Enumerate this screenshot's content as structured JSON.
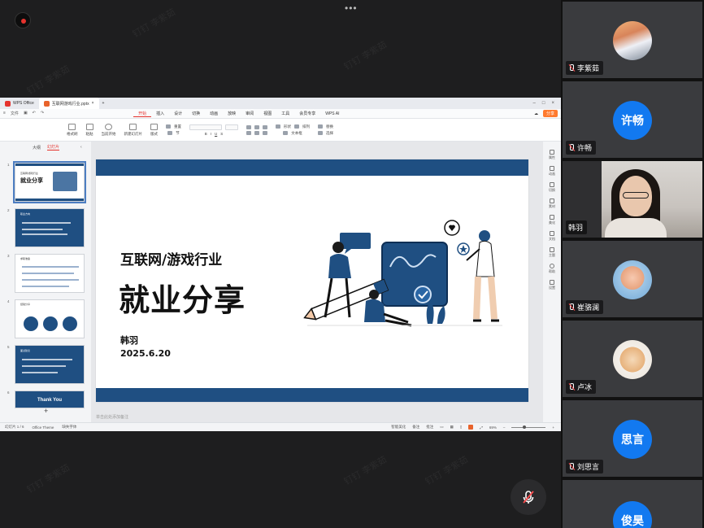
{
  "meeting": {
    "more_dots": "•••",
    "watermark": "钉钉 李紫茹"
  },
  "wps": {
    "tabs": [
      "WPS Office",
      "互联网游戏行业.pptx"
    ],
    "menu": [
      "开始",
      "插入",
      "设计",
      "切换",
      "动画",
      "放映",
      "审阅",
      "视图",
      "工具",
      "会员专享",
      "WPS AI"
    ],
    "menu_active": "开始",
    "file_menu": "文件",
    "share_label": "分享",
    "ribbon_labels": [
      "格式刷",
      "粘贴",
      "当前开始",
      "新建幻灯片",
      "版式",
      "重置",
      "节",
      "形状",
      "排列",
      "文本框",
      "替换",
      "选择"
    ],
    "thumb_tabs": [
      "大纲",
      "幻灯片"
    ],
    "thumb_tab_active": "幻灯片",
    "thumbnails": [
      {
        "num": "1",
        "title": "就业分享",
        "small": "互联网/游戏行业"
      },
      {
        "num": "2",
        "small": "职业方向"
      },
      {
        "num": "3",
        "small": "求职准备"
      },
      {
        "num": "4",
        "small": "经验分享"
      },
      {
        "num": "5",
        "small": "面试建议"
      },
      {
        "num": "6",
        "title": "Thank You"
      }
    ],
    "slide": {
      "subtitle": "互联网/游戏行业",
      "title": "就业分享",
      "name": "韩羽",
      "date": "2025.6.20"
    },
    "notes_placeholder": "单击此处添加备注",
    "side_tools": [
      "属性",
      "动画",
      "切换",
      "素材",
      "美化",
      "文档",
      "主题",
      "帮助",
      "设置"
    ],
    "status": {
      "slide_counter": "幻灯片 1 / 6",
      "theme": "Office Theme",
      "font_missing": "缺失字体",
      "smart_beautify": "智能美化",
      "notes": "备注",
      "comments": "批注",
      "zoom": "69%"
    }
  },
  "participants": [
    {
      "name": "李紫茹",
      "avatar_type": "photo",
      "muted": true
    },
    {
      "name": "许畅",
      "avatar_text": "许畅",
      "avatar_color": "#1279f0",
      "muted": true
    },
    {
      "name": "韩羽",
      "avatar_type": "camera",
      "muted": false,
      "speaking": true
    },
    {
      "name": "崔骆澜",
      "avatar_type": "photo",
      "muted": true
    },
    {
      "name": "卢冰",
      "avatar_type": "photo",
      "muted": true
    },
    {
      "name": "刘思言",
      "avatar_text": "思言",
      "avatar_color": "#1279f0",
      "muted": true
    },
    {
      "name": "",
      "avatar_text": "俊昊",
      "avatar_color": "#1279f0",
      "muted": true
    }
  ],
  "colors": {
    "accent_blue": "#1f4f82",
    "speaker_green": "#2fbf4a",
    "wps_red": "#e5322d",
    "avatar_blue": "#1279f0"
  }
}
